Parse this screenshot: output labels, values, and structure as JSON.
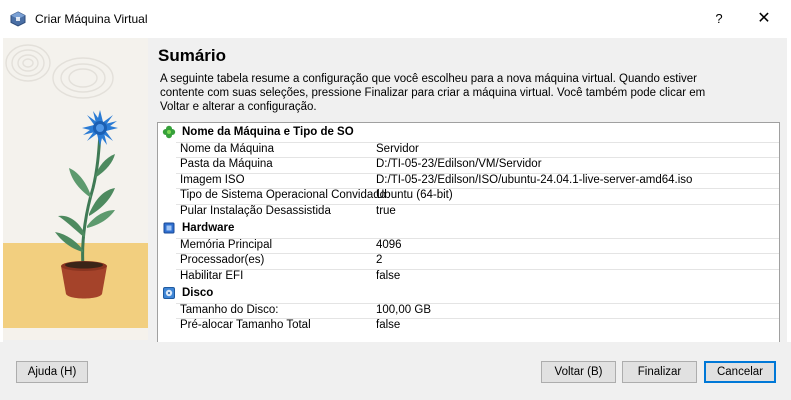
{
  "window": {
    "title": "Criar Máquina Virtual",
    "help_label": "?",
    "close_label": "✕"
  },
  "page": {
    "heading": "Sumário",
    "description": "A seguinte tabela resume a configuração que você escolheu para a nova máquina virtual. Quando estiver contente com suas seleções, pressione Finalizar para criar a máquina virtual. Você também pode clicar em Voltar e alterar a configuração."
  },
  "summary": {
    "sections": [
      {
        "title": "Nome da Máquina e Tipo de SO",
        "icon": "clover-icon",
        "items": [
          {
            "key": "Nome da Máquina",
            "value": "Servidor"
          },
          {
            "key": "Pasta da Máquina",
            "value": "D:/TI-05-23/Edilson/VM/Servidor"
          },
          {
            "key": "Imagem ISO",
            "value": "D:/TI-05-23/Edilson/ISO/ubuntu-24.04.1-live-server-amd64.iso"
          },
          {
            "key": "Tipo de Sistema Operacional Convidado",
            "value": "Ubuntu (64-bit)"
          },
          {
            "key": "Pular Instalação Desassistida",
            "value": "true"
          }
        ]
      },
      {
        "title": "Hardware",
        "icon": "chip-icon",
        "items": [
          {
            "key": "Memória Principal",
            "value": "4096"
          },
          {
            "key": "Processador(es)",
            "value": "2"
          },
          {
            "key": "Habilitar EFI",
            "value": "false"
          }
        ]
      },
      {
        "title": "Disco",
        "icon": "disk-icon",
        "items": [
          {
            "key": "Tamanho do Disco:",
            "value": "100,00 GB"
          },
          {
            "key": "Pré-alocar Tamanho Total",
            "value": "false"
          }
        ]
      }
    ]
  },
  "buttons": {
    "help": "Ajuda (H)",
    "back": "Voltar (B)",
    "finish": "Finalizar",
    "cancel": "Cancelar"
  },
  "colors": {
    "accent": "#0078d7",
    "panel_bg": "#f0f0f0",
    "button_bg": "#e1e1e1",
    "flower_blue": "#2a7bd4",
    "pot": "#a5432a",
    "floor": "#f2cf7f"
  }
}
